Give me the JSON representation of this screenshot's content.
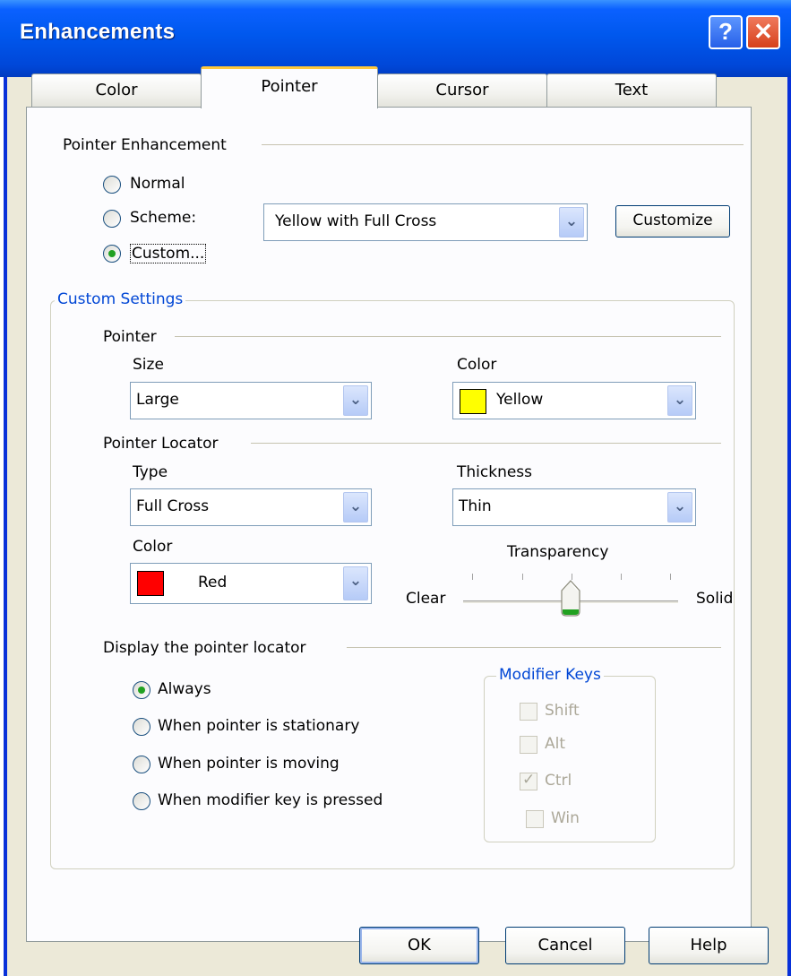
{
  "window": {
    "title": "Enhancements",
    "help_glyph": "?",
    "close_glyph": "✕"
  },
  "tabs": [
    {
      "label": "Color",
      "active": false
    },
    {
      "label": "Pointer",
      "active": true
    },
    {
      "label": "Cursor",
      "active": false
    },
    {
      "label": "Text",
      "active": false
    }
  ],
  "pointer_enhancement": {
    "heading": "Pointer Enhancement",
    "options": [
      "Normal",
      "Scheme:",
      "Custom..."
    ],
    "selected": "Custom...",
    "scheme_value": "Yellow with Full Cross",
    "customize_label": "Customize"
  },
  "custom_settings": {
    "heading": "Custom Settings",
    "pointer": {
      "heading": "Pointer",
      "size_label": "Size",
      "size_value": "Large",
      "color_label": "Color",
      "color_value": "Yellow",
      "color_hex": "#ffff00"
    },
    "locator": {
      "heading": "Pointer Locator",
      "type_label": "Type",
      "type_value": "Full Cross",
      "thickness_label": "Thickness",
      "thickness_value": "Thin",
      "color_label": "Color",
      "color_value": "Red",
      "color_hex": "#ff0000",
      "transparency_label": "Transparency",
      "transparency_min": "Clear",
      "transparency_max": "Solid",
      "transparency_level": 0.5
    },
    "display": {
      "heading": "Display the pointer locator",
      "options": [
        "Always",
        "When pointer is stationary",
        "When pointer is moving",
        "When modifier key is pressed"
      ],
      "selected": "Always"
    },
    "modifier_keys": {
      "heading": "Modifier Keys",
      "keys": [
        {
          "label": "Shift",
          "checked": false
        },
        {
          "label": "Alt",
          "checked": false
        },
        {
          "label": "Ctrl",
          "checked": true
        },
        {
          "label": "Win",
          "checked": false
        }
      ]
    }
  },
  "footer": {
    "ok_label": "OK",
    "cancel_label": "Cancel",
    "help_label": "Help"
  },
  "colors": {
    "title_bar": "#0058ee",
    "group_label": "#0046d5",
    "radio_check": "#21a121",
    "tab_highlight": "#ffc83c"
  }
}
